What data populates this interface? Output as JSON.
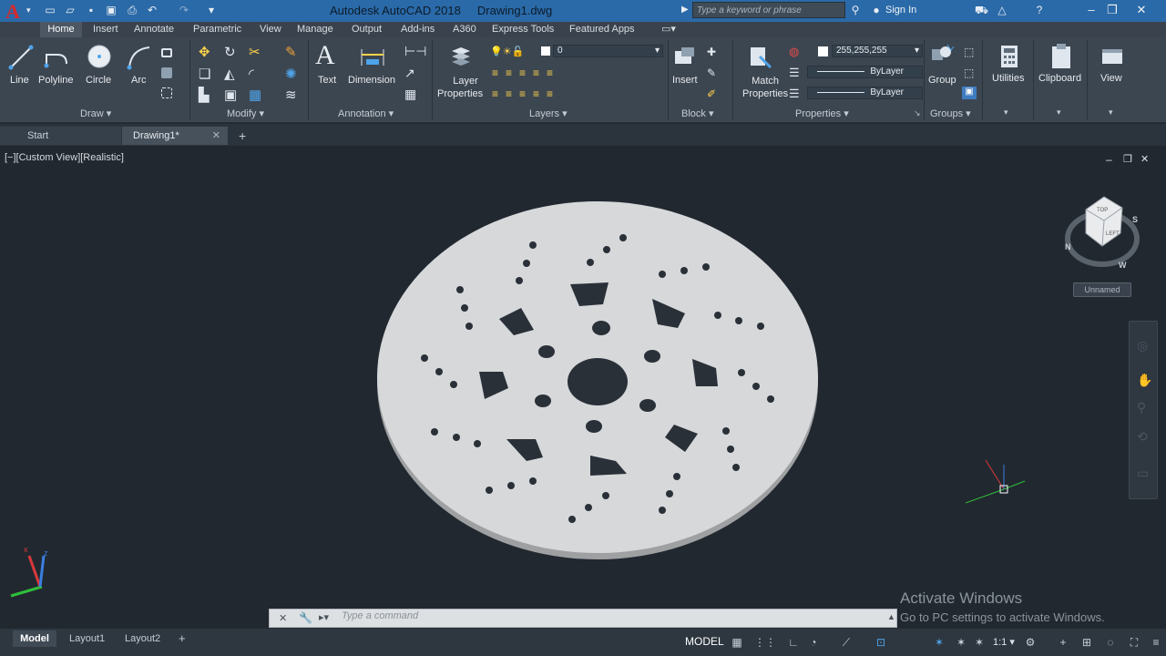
{
  "app": {
    "title": "Autodesk AutoCAD 2018",
    "document": "Drawing1.dwg",
    "logo_letter": "A",
    "search_placeholder": "Type a keyword or phrase",
    "sign_in": "Sign In"
  },
  "ribbon_tabs": [
    "Home",
    "Insert",
    "Annotate",
    "Parametric",
    "View",
    "Manage",
    "Output",
    "Add-ins",
    "A360",
    "Express Tools",
    "Featured Apps"
  ],
  "panels": {
    "draw": {
      "label": "Draw",
      "tools": [
        "Line",
        "Polyline",
        "Circle",
        "Arc"
      ]
    },
    "modify": {
      "label": "Modify"
    },
    "annotation": {
      "label": "Annotation",
      "tools": [
        "Text",
        "Dimension"
      ]
    },
    "layers": {
      "label": "Layers",
      "layer_properties_1": "Layer",
      "layer_properties_2": "Properties",
      "current_layer": "0"
    },
    "block": {
      "label": "Block",
      "insert": "Insert"
    },
    "properties": {
      "label": "Properties",
      "match_1": "Match",
      "match_2": "Properties",
      "color": "255,255,255",
      "linetype": "ByLayer",
      "lineweight": "ByLayer"
    },
    "groups": {
      "label": "Groups",
      "group": "Group"
    },
    "utilities": {
      "label": "Utilities"
    },
    "clipboard": {
      "label": "Clipboard"
    },
    "view": {
      "label": "View"
    }
  },
  "doc_tabs": {
    "start": "Start",
    "drawing": "Drawing1*"
  },
  "viewport": {
    "label": "[−][Custom View][Realistic]",
    "viewcube_label": "Unnamed",
    "cube_faces": {
      "top": "TOP",
      "front": "LEFT"
    },
    "compass": {
      "n": "N",
      "s": "S",
      "w": "W"
    }
  },
  "command": {
    "placeholder": "Type a command"
  },
  "watermark": {
    "line1": "Activate Windows",
    "line2": "Go to PC settings to activate Windows."
  },
  "layout_tabs": [
    "Model",
    "Layout1",
    "Layout2"
  ],
  "status": {
    "model": "MODEL",
    "scale": "1:1"
  },
  "colors": {
    "accent": "#2b6aa8",
    "ribbon": "#3c4651",
    "viewport": "#212830",
    "disk": "#d6d8da"
  }
}
